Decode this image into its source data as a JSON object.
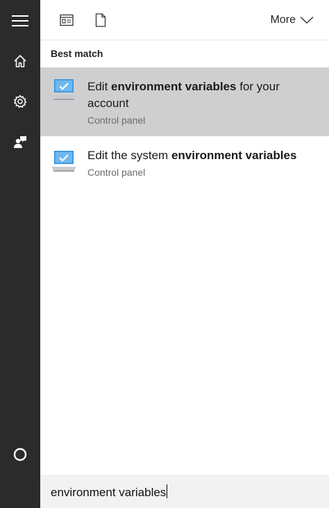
{
  "rail": {
    "items": [
      {
        "name": "menu",
        "icon": "hamburger-menu-icon"
      },
      {
        "name": "home",
        "icon": "home-icon"
      },
      {
        "name": "settings",
        "icon": "gear-icon"
      },
      {
        "name": "feedback",
        "icon": "feedback-person-icon"
      },
      {
        "name": "cortana",
        "icon": "cortana-circle-icon"
      }
    ]
  },
  "toolbar": {
    "filter_apps_icon": "apps-filter-icon",
    "filter_docs_icon": "document-icon",
    "more_label": "More"
  },
  "section": {
    "best_match_label": "Best match"
  },
  "results": [
    {
      "title_pre": "Edit ",
      "title_bold": "environment variables",
      "title_post": " for your account",
      "subtitle": "Control panel",
      "icon": "monitor-checkmark-icon",
      "selected": true
    },
    {
      "title_pre": "Edit the system ",
      "title_bold": "environment variables",
      "title_post": "",
      "subtitle": "Control panel",
      "icon": "monitor-checkmark-icon",
      "selected": false
    }
  ],
  "search": {
    "query": "environment variables"
  },
  "colors": {
    "rail_bg": "#2b2b2b",
    "selected_bg": "#cfcfcf",
    "search_bg": "#f2f2f2",
    "monitor_blue": "#2f8fdc"
  }
}
